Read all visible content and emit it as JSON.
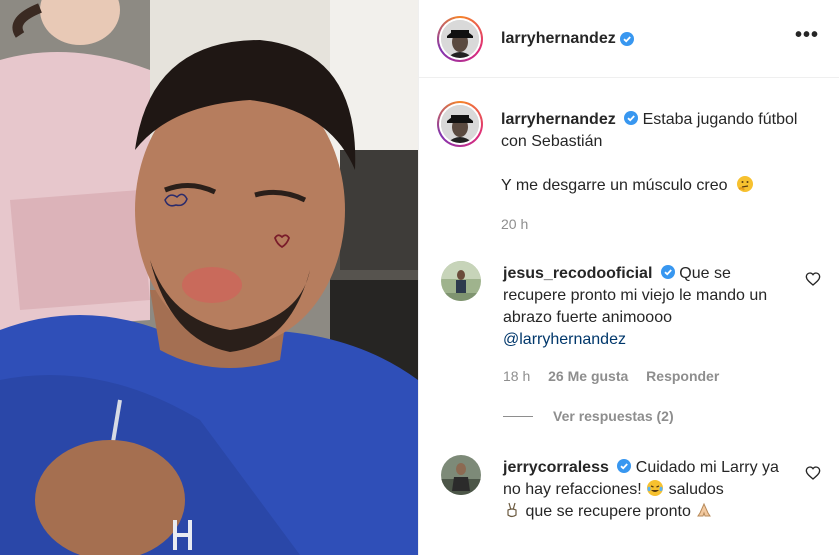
{
  "header": {
    "username": "larryhernandez",
    "more_label": "•••"
  },
  "caption": {
    "username": "larryhernandez",
    "text1": "Estaba jugando fútbol con Sebastián",
    "text2": "Y me desgarre un músculo creo",
    "time": "20 h"
  },
  "comments": [
    {
      "username": "jesus_recodooficial",
      "text": "Que se recupere pronto mi viejo le mando un abrazo fuerte animoooo",
      "mention": "@larryhernandez",
      "time": "18 h",
      "likes": "26 Me gusta",
      "reply": "Responder",
      "view_replies": "Ver respuestas (2)"
    },
    {
      "username": "jerrycorraless",
      "text1": "Cuidado mi Larry ya no hay refacciones!",
      "text2": "saludos",
      "text3": "que se recupere pronto"
    }
  ],
  "colors": {
    "verified": "#3897f0",
    "mention": "#00376b",
    "muted": "#8e8e8e"
  }
}
